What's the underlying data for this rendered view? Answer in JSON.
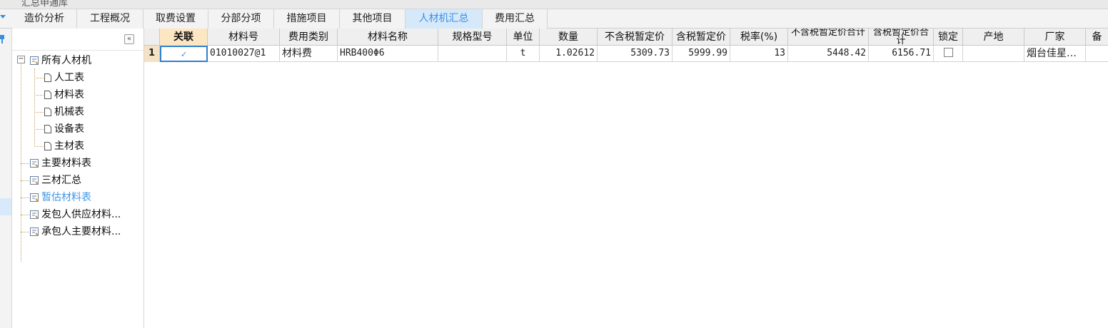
{
  "window": {
    "top_title_fragment": "汇总申通库"
  },
  "tabs": [
    {
      "label": "造价分析",
      "active": false
    },
    {
      "label": "工程概况",
      "active": false
    },
    {
      "label": "取费设置",
      "active": false
    },
    {
      "label": "分部分项",
      "active": false
    },
    {
      "label": "措施项目",
      "active": false
    },
    {
      "label": "其他项目",
      "active": false
    },
    {
      "label": "人材机汇总",
      "active": true
    },
    {
      "label": "费用汇总",
      "active": false
    }
  ],
  "sidebar": {
    "collapse_label": "«",
    "expander_label": "−",
    "items": [
      {
        "label": "所有人材机",
        "level": 0
      },
      {
        "label": "人工表",
        "level": 1
      },
      {
        "label": "材料表",
        "level": 1
      },
      {
        "label": "机械表",
        "level": 1
      },
      {
        "label": "设备表",
        "level": 1
      },
      {
        "label": "主材表",
        "level": 1
      },
      {
        "label": "主要材料表",
        "level": 0
      },
      {
        "label": "三材汇总",
        "level": 0
      },
      {
        "label": "暂估材料表",
        "level": 0,
        "selected": true
      },
      {
        "label": "发包人供应材料...",
        "level": 0
      },
      {
        "label": "承包人主要材料...",
        "level": 0
      }
    ]
  },
  "table": {
    "columns": [
      {
        "label": "关联"
      },
      {
        "label": "材料号"
      },
      {
        "label": "费用类别"
      },
      {
        "label": "材料名称"
      },
      {
        "label": "规格型号"
      },
      {
        "label": "单位"
      },
      {
        "label": "数量"
      },
      {
        "label": "不含税暂定价"
      },
      {
        "label": "含税暂定价"
      },
      {
        "label": "税率(%)"
      },
      {
        "label": "不含税暂定价合计"
      },
      {
        "label": "含税暂定价合计"
      },
      {
        "label": "锁定"
      },
      {
        "label": "产地"
      },
      {
        "label": "厂家"
      },
      {
        "label": "备"
      }
    ],
    "rows": [
      {
        "index": "1",
        "linked": "✓",
        "material_code": "01010027@1",
        "cost_category": "材料费",
        "material_name": "HRB400Φ6",
        "spec": "",
        "unit": "t",
        "quantity": "1.02612",
        "price_excl_tax": "5309.73",
        "price_incl_tax": "5999.99",
        "tax_rate": "13",
        "total_excl_tax": "5448.42",
        "total_incl_tax": "6156.71",
        "locked": false,
        "origin": "",
        "manufacturer": "烟台佳星…"
      }
    ]
  },
  "colors": {
    "accent": "#3a8ee6",
    "active_tab_bg": "#d6e9fa",
    "header_highlight": "#fde6c2",
    "selection_border": "#2f7fd0"
  }
}
